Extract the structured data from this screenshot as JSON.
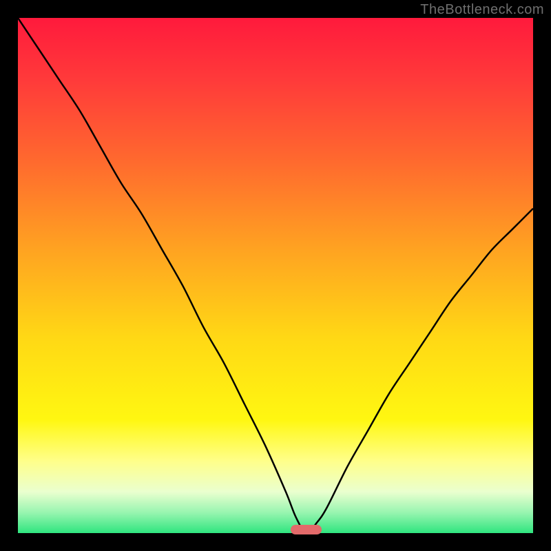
{
  "watermark": "TheBottleneck.com",
  "chart_data": {
    "type": "line",
    "title": "",
    "xlabel": "",
    "ylabel": "",
    "xlim": [
      0,
      100
    ],
    "ylim": [
      0,
      100
    ],
    "grid": false,
    "legend": false,
    "series": [
      {
        "name": "curve",
        "x": [
          0,
          4,
          8,
          12,
          16,
          20,
          24,
          28,
          32,
          36,
          40,
          44,
          48,
          52,
          54,
          56,
          58,
          60,
          64,
          68,
          72,
          76,
          80,
          84,
          88,
          92,
          96,
          100
        ],
        "y": [
          100,
          94,
          88,
          82,
          75,
          68,
          62,
          55,
          48,
          40,
          33,
          25,
          17,
          8,
          3,
          0,
          2,
          5,
          13,
          20,
          27,
          33,
          39,
          45,
          50,
          55,
          59,
          63
        ]
      }
    ],
    "optimal_marker": {
      "x_center": 56,
      "width_pct": 6
    }
  },
  "colors": {
    "gradient_top": "#ff1a3c",
    "gradient_bottom": "#2fe57f",
    "curve": "#000000",
    "marker": "#e36a6a",
    "frame": "#000000",
    "watermark": "#6f6f6f"
  }
}
